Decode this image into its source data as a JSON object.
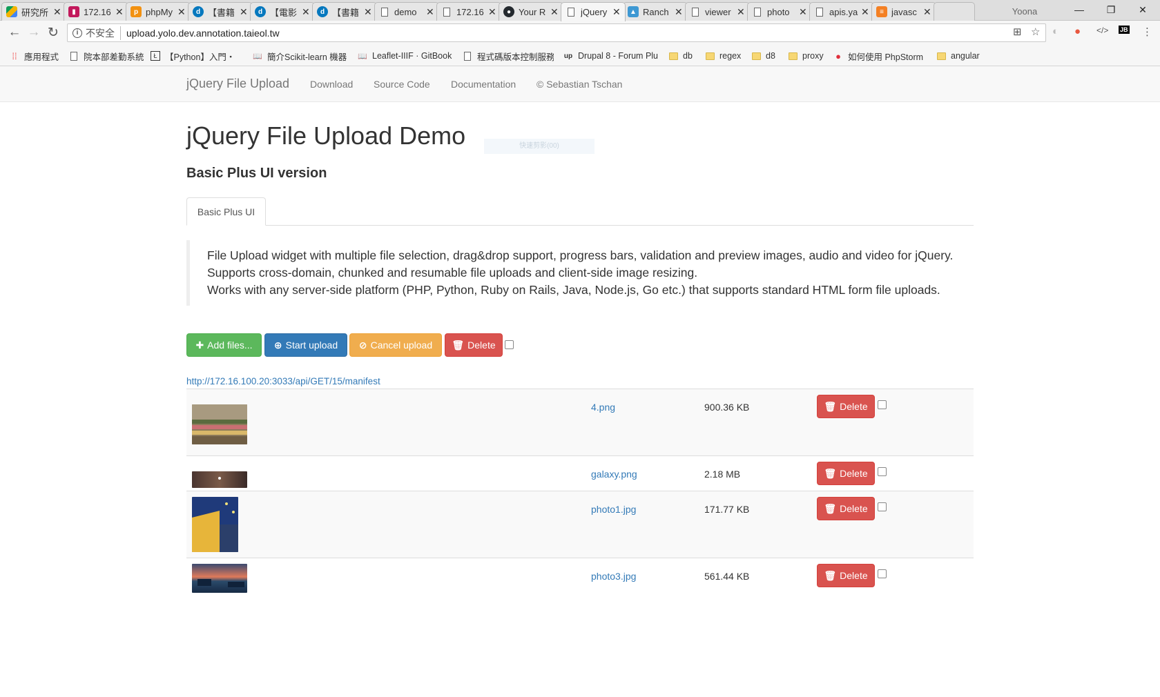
{
  "browser": {
    "tabs": [
      {
        "title": "研究所",
        "fav_color": "#4285f4",
        "active": false
      },
      {
        "title": "172.16",
        "fav_color": "#c2185b",
        "active": false
      },
      {
        "title": "phpMy",
        "fav_color": "#f29111",
        "active": false
      },
      {
        "title": "【書籍",
        "fav_color": "#0678be",
        "active": false
      },
      {
        "title": "【電影",
        "fav_color": "#0678be",
        "active": false
      },
      {
        "title": "【書籍",
        "fav_color": "#0678be",
        "active": false
      },
      {
        "title": "demo",
        "fav_color": "#ffffff",
        "active": false
      },
      {
        "title": "172.16",
        "fav_color": "#ffffff",
        "active": false
      },
      {
        "title": "Your R",
        "fav_color": "#24292e",
        "active": false
      },
      {
        "title": "jQuery",
        "fav_color": "#ffffff",
        "active": true
      },
      {
        "title": "Ranch",
        "fav_color": "#3d98d3",
        "active": false
      },
      {
        "title": "viewer",
        "fav_color": "#ffffff",
        "active": false
      },
      {
        "title": "photo",
        "fav_color": "#ffffff",
        "active": false
      },
      {
        "title": "apis.ya",
        "fav_color": "#ffffff",
        "active": false
      },
      {
        "title": "javasc",
        "fav_color": "#f48024",
        "active": false
      }
    ],
    "profile_name": "Yoona",
    "omnibox": {
      "security_label": "不安全",
      "url": "upload.yolo.dev.annotation.taieol.tw"
    },
    "bookmarks": [
      {
        "label": "應用程式",
        "type": "apps"
      },
      {
        "label": "院本部差勤系統",
        "type": "page"
      },
      {
        "label": "【Python】入門・",
        "type": "page"
      },
      {
        "label": "簡介Scikit-learn 機器",
        "type": "page"
      },
      {
        "label": "Leaflet-IIIF · GitBook",
        "type": "page"
      },
      {
        "label": "程式碼版本控制服務",
        "type": "page"
      },
      {
        "label": "Drupal 8 - Forum Plu",
        "type": "page"
      },
      {
        "label": "db",
        "type": "folder"
      },
      {
        "label": "regex",
        "type": "folder"
      },
      {
        "label": "d8",
        "type": "folder"
      },
      {
        "label": "proxy",
        "type": "folder"
      },
      {
        "label": "如何使用 PhpStorm",
        "type": "page"
      },
      {
        "label": "angular",
        "type": "folder"
      }
    ]
  },
  "navbar": {
    "brand": "jQuery File Upload",
    "links": [
      "Download",
      "Source Code",
      "Documentation",
      "© Sebastian Tschan"
    ]
  },
  "page": {
    "title": "jQuery File Upload Demo",
    "ghost_text": "快速剪影(00)",
    "subtitle": "Basic Plus UI version",
    "tab_label": "Basic Plus UI",
    "description": [
      "File Upload widget with multiple file selection, drag&drop support, progress bars, validation and preview images, audio and video for jQuery.",
      "Supports cross-domain, chunked and resumable file uploads and client-side image resizing.",
      "Works with any server-side platform (PHP, Python, Ruby on Rails, Java, Node.js, Go etc.) that supports standard HTML form file uploads."
    ]
  },
  "toolbar": {
    "add_label": "Add files...",
    "start_label": "Start upload",
    "cancel_label": "Cancel upload",
    "delete_label": "Delete"
  },
  "manifest_link": "http://172.16.100.20:3033/api/GET/15/manifest",
  "files": [
    {
      "name": "4.png",
      "size": "900.36 KB",
      "delete_label": "Delete"
    },
    {
      "name": "galaxy.png",
      "size": "2.18 MB",
      "delete_label": "Delete"
    },
    {
      "name": "photo1.jpg",
      "size": "171.77 KB",
      "delete_label": "Delete"
    },
    {
      "name": "photo3.jpg",
      "size": "561.44 KB",
      "delete_label": "Delete"
    }
  ]
}
